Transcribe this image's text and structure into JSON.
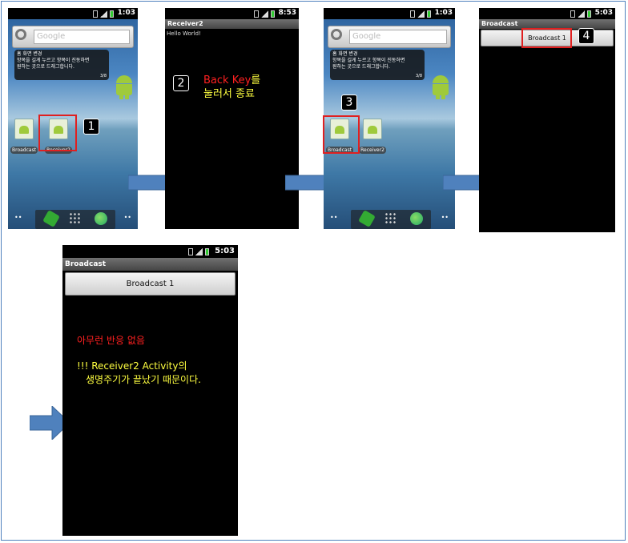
{
  "colors": {
    "frame_border": "#4f81bd",
    "arrow_fill": "#4f81bd",
    "highlight": "#e02020",
    "text_red": "#ff2020",
    "text_yellow": "#ffff40"
  },
  "phone1": {
    "time": "1:03",
    "search_placeholder": "Google",
    "tip_title": "홈 화면 변경",
    "tip_line1": "항목을 길게 누르고 항목이 진동하면",
    "tip_line2": "원하는 곳으로 드래그합니다.",
    "tip_page": "3/8",
    "apps": [
      "Broadcast",
      "Receiver2"
    ],
    "badge": "1"
  },
  "phone2": {
    "time": "8:53",
    "title": "Receiver2",
    "content": "Hello World!",
    "badge": "2",
    "note_line1_red": "Back Key",
    "note_line1_yellow": "를",
    "note_line2": "눌러서 종료"
  },
  "phone3": {
    "time": "1:03",
    "search_placeholder": "Google",
    "tip_title": "홈 화면 변경",
    "tip_line1": "항목을 길게 누르고 항목이 진동하면",
    "tip_line2": "원하는 곳으로 드래그합니다.",
    "tip_page": "3/8",
    "apps": [
      "Broadcast",
      "Receiver2"
    ],
    "badge": "3"
  },
  "phone4": {
    "time": "5:03",
    "title": "Broadcast",
    "button_label": "Broadcast 1",
    "badge": "4"
  },
  "phone5": {
    "time": "5:03",
    "title": "Broadcast",
    "button_label": "Broadcast 1",
    "note_red": "아무런 반응 없음",
    "note_yellow_line1": "!!! Receiver2 Activity의",
    "note_yellow_line2": "생명주기가 끝났기 때문이다."
  }
}
